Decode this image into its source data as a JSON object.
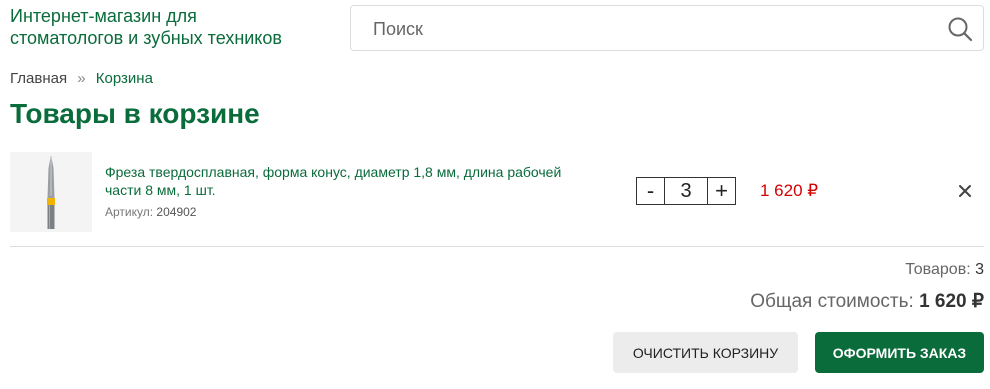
{
  "header": {
    "store_title_line1": "Интернет-магазин для",
    "store_title_line2": "стоматологов и зубных техников",
    "search": {
      "placeholder": "Поиск",
      "value": "",
      "icon": "search-icon"
    }
  },
  "breadcrumb": {
    "home": "Главная",
    "separator": "»",
    "current": "Корзина"
  },
  "page_title": "Товары в корзине",
  "cart": {
    "items": [
      {
        "name": "Фреза твердосплавная, форма конус, диаметр 1,8 мм, длина рабочей части 8 мм, 1 шт.",
        "sku_label": "Артикул:",
        "sku": "204902",
        "qty_minus": "-",
        "quantity": "3",
        "qty_plus": "+",
        "price": "1 620 ₽",
        "remove_icon": "close-icon"
      }
    ]
  },
  "summary": {
    "count_label": "Товаров:",
    "count_value": "3",
    "total_label": "Общая стоимость:",
    "total_value": "1 620 ₽"
  },
  "actions": {
    "clear_label": "ОЧИСТИТЬ КОРЗИНУ",
    "checkout_label": "ОФОРМИТЬ ЗАКАЗ"
  },
  "colors": {
    "brand_green": "#0a6b3b",
    "price_red": "#d40000",
    "clear_bg": "#ececec"
  }
}
